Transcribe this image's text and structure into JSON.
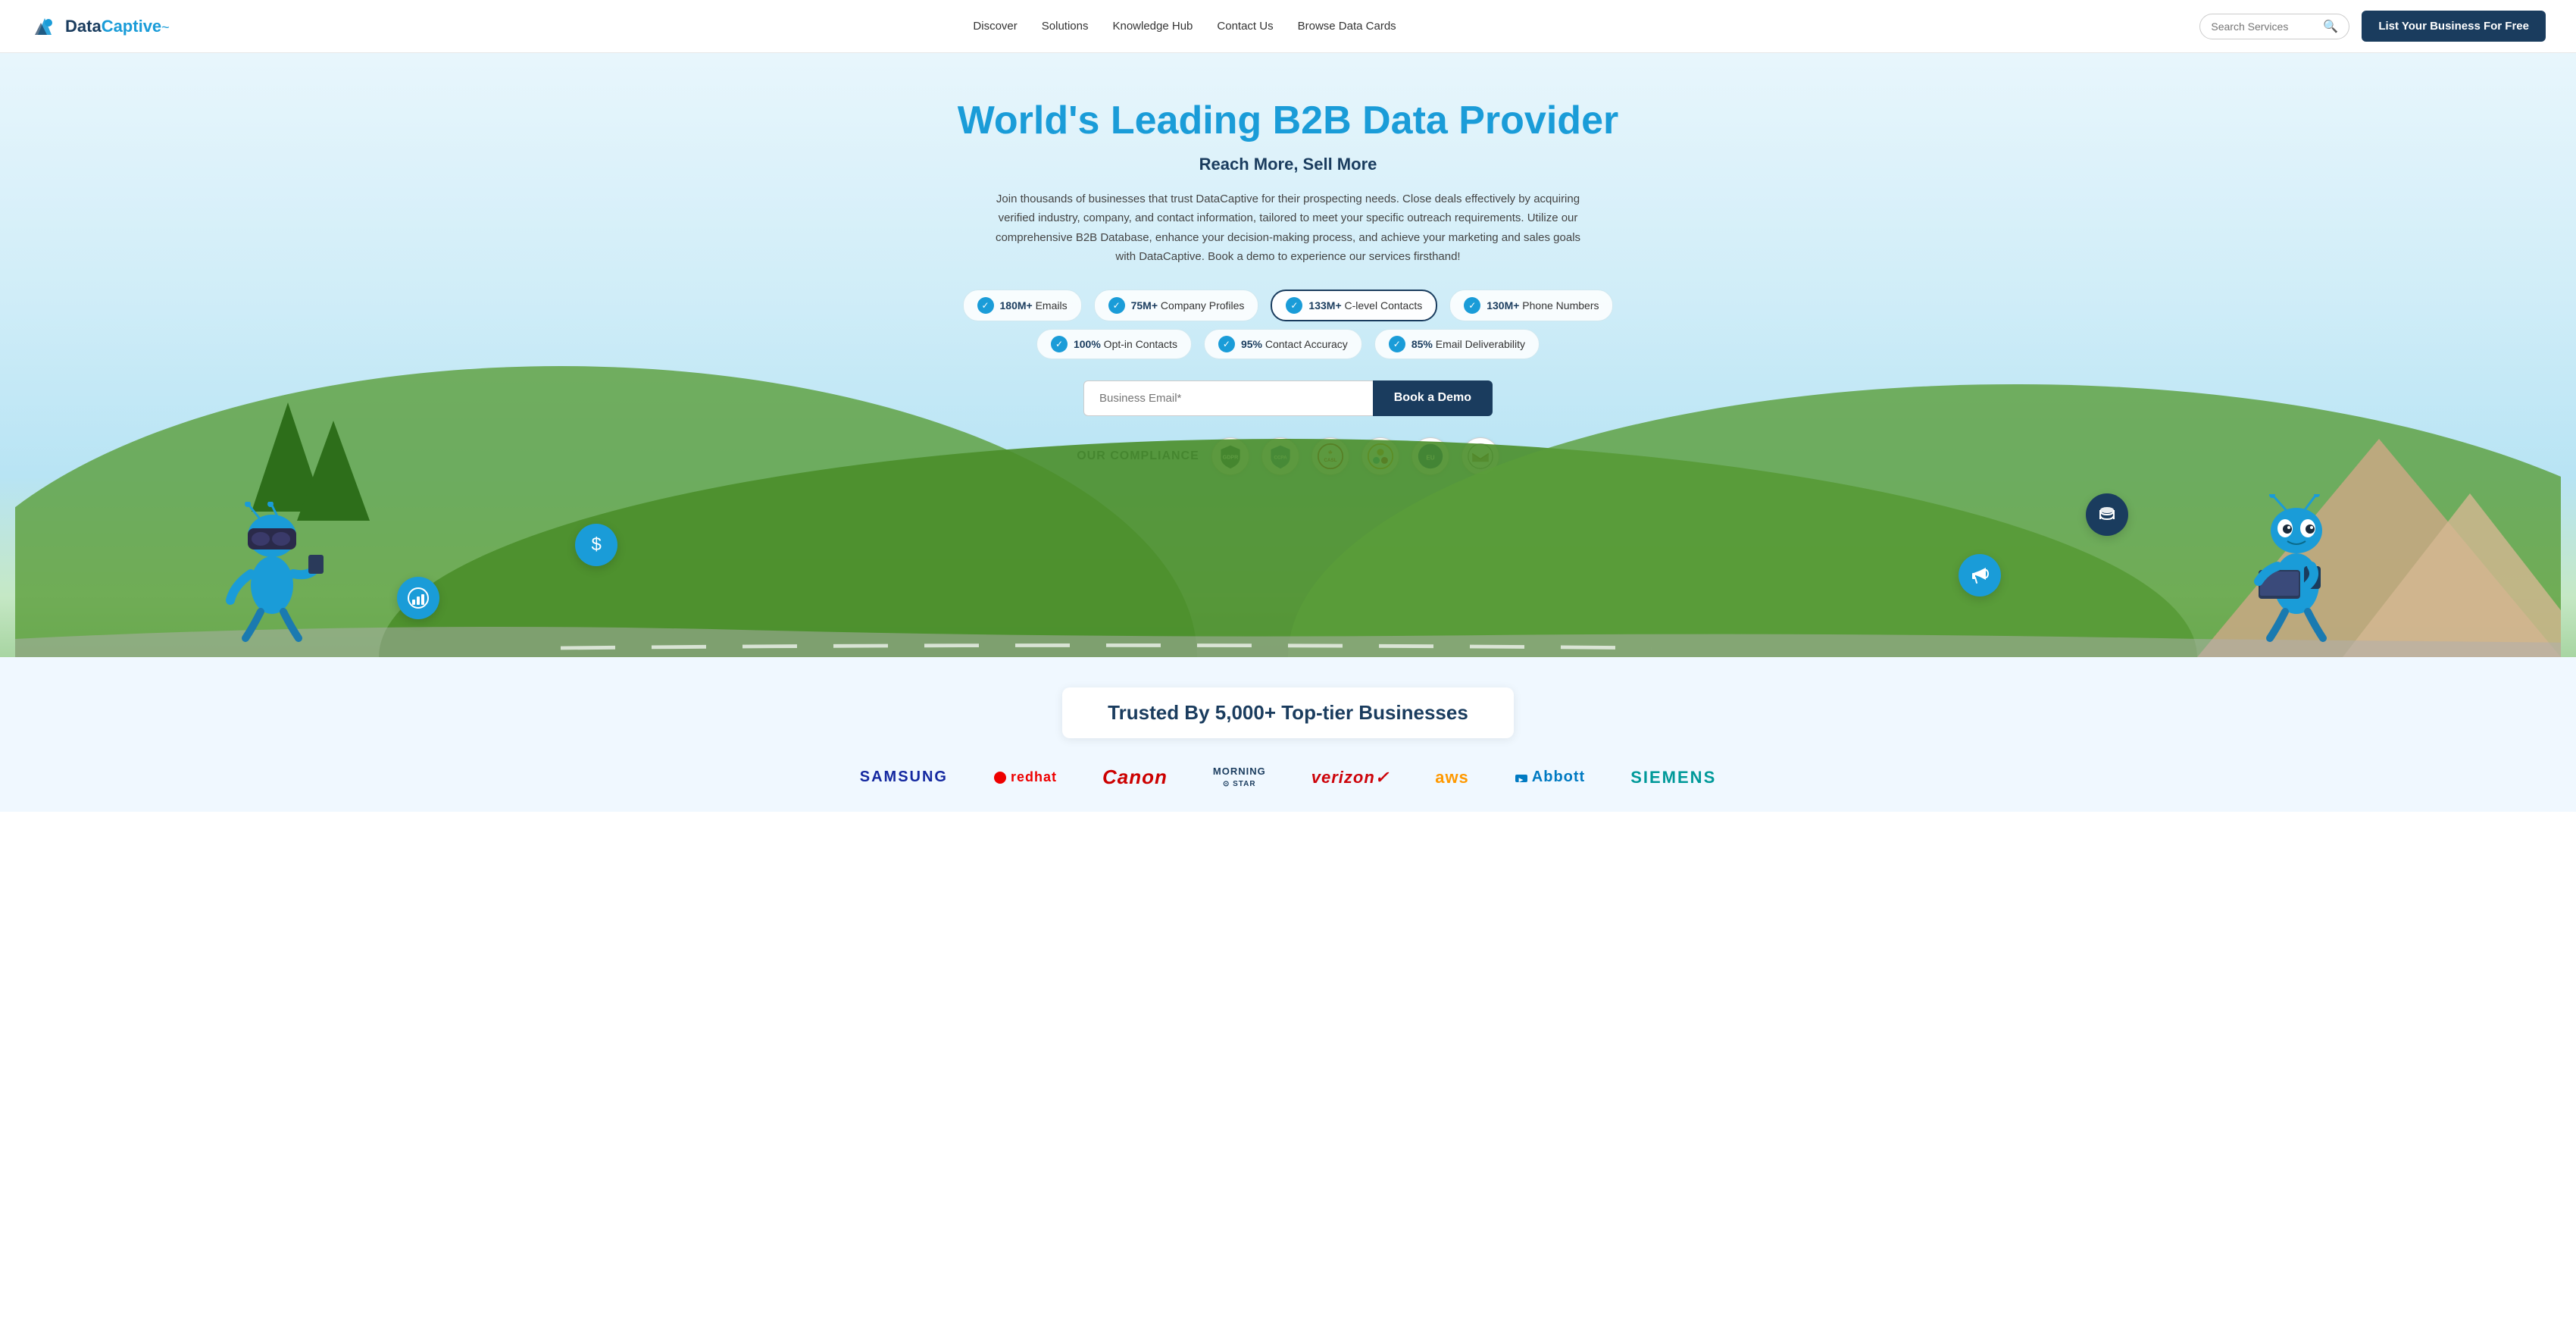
{
  "navbar": {
    "logo": {
      "data_text": "Data",
      "captive_text": "Captive",
      "tilde": "~"
    },
    "nav_links": [
      {
        "label": "Discover",
        "id": "discover"
      },
      {
        "label": "Solutions",
        "id": "solutions"
      },
      {
        "label": "Knowledge Hub",
        "id": "knowledge-hub"
      },
      {
        "label": "Contact Us",
        "id": "contact-us"
      },
      {
        "label": "Browse Data Cards",
        "id": "browse-data"
      }
    ],
    "search_placeholder": "Search Services",
    "cta_label": "List Your Business For Free"
  },
  "hero": {
    "title": "World's Leading B2B Data Provider",
    "subtitle": "Reach More, Sell More",
    "description": "Join thousands of businesses that trust DataCaptive for their prospecting needs. Close deals effectively by acquiring verified industry, company, and contact information, tailored to meet your specific outreach requirements. Utilize our comprehensive B2B Database, enhance your decision-making process, and achieve your marketing and sales goals with DataCaptive. Book a demo to experience our services firsthand!",
    "stats_row1": [
      {
        "num": "180M+",
        "label": "Emails",
        "highlighted": false
      },
      {
        "num": "75M+",
        "label": "Company Profiles",
        "highlighted": false
      },
      {
        "num": "133M+",
        "label": "C-level Contacts",
        "highlighted": true
      },
      {
        "num": "130M+",
        "label": "Phone Numbers",
        "highlighted": false
      }
    ],
    "stats_row2": [
      {
        "num": "100%",
        "label": "Opt-in Contacts",
        "highlighted": false
      },
      {
        "num": "95%",
        "label": "Contact Accuracy",
        "highlighted": false
      },
      {
        "num": "85%",
        "label": "Email Deliverability",
        "highlighted": false
      }
    ],
    "email_placeholder": "Business Email*",
    "book_demo_label": "Book a Demo",
    "compliance_label": "OUR COMPLIANCE",
    "compliance_badges": [
      {
        "label": "GDPR",
        "color": "#1a3c5e"
      },
      {
        "label": "CCPA",
        "color": "#1a5c8e"
      },
      {
        "label": "CASL",
        "color": "#cc0000"
      },
      {
        "label": "PIPEDA",
        "color": "#ff8800"
      },
      {
        "label": "EU",
        "color": "#003399"
      },
      {
        "label": "CAN-SPAM",
        "color": "#8b0000"
      }
    ]
  },
  "floating_icons": {
    "dollar": "$",
    "chart": "📊",
    "database": "🗄",
    "megaphone": "📢"
  },
  "trusted": {
    "banner_text": "Trusted By 5,000+ Top-tier Businesses",
    "brands": [
      {
        "label": "SAMSUNG",
        "class": "samsung"
      },
      {
        "label": "● redhat",
        "class": "redhat"
      },
      {
        "label": "Canon",
        "class": "canon"
      },
      {
        "label": "MORNING⊙",
        "class": "morning"
      },
      {
        "label": "verizon✓",
        "class": "verizon"
      },
      {
        "label": "aws",
        "class": "aws"
      },
      {
        "label": "□ Abbott",
        "class": "abbott"
      },
      {
        "label": "SIEMENS",
        "class": "siemens"
      }
    ]
  }
}
